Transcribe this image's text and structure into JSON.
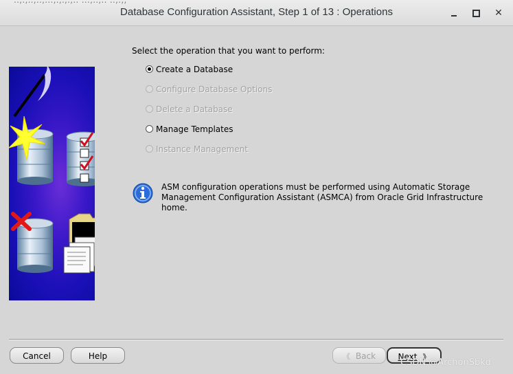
{
  "window": {
    "title": "Database Configuration Assistant, Step 1 of 13 : Operations",
    "ghost_text": "..,.,..,..,...,.,.,.,.. ...,..,.. ..,.,,"
  },
  "main": {
    "prompt": "Select the operation that you want to perform:",
    "options": [
      {
        "label": "Create a Database",
        "selected": true,
        "enabled": true
      },
      {
        "label": "Configure Database Options",
        "selected": false,
        "enabled": false
      },
      {
        "label": "Delete a Database",
        "selected": false,
        "enabled": false
      },
      {
        "label": "Manage Templates",
        "selected": false,
        "enabled": true
      },
      {
        "label": "Instance Management",
        "selected": false,
        "enabled": false
      }
    ],
    "info_line1": "ASM configuration operations must be performed using Automatic Storage",
    "info_line2": "Management Configuration Assistant (ASMCA) from Oracle Grid Infrastructure home."
  },
  "footer": {
    "cancel_label": "Cancel",
    "help_label": "Help",
    "back_label": "Back",
    "next_label": "Next",
    "watermark": "CSDN @ArchonSbkd"
  },
  "colors": {
    "background": "#d6d6d6",
    "image_blue": "#1b10b8",
    "info_blue": "#2b6cd8",
    "check_red": "#d01020"
  },
  "icons": {
    "info": "info-icon",
    "minimize": "minimize-icon",
    "maximize": "maximize-icon",
    "close": "close-icon"
  }
}
